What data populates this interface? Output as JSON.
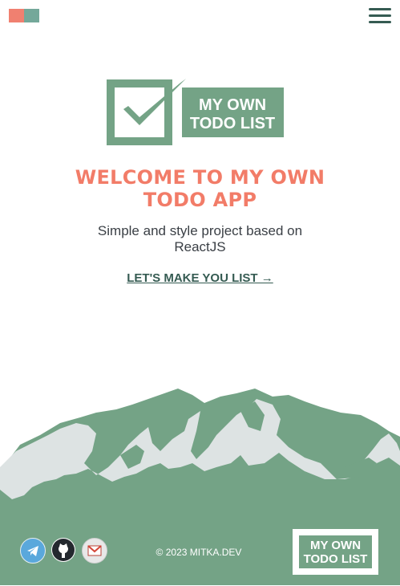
{
  "header": {
    "logo_icon": "brand-squares-icon",
    "menu_icon": "hamburger-menu-icon"
  },
  "hero": {
    "logo_line1": "MY OWN",
    "logo_line2": "TODO LIST",
    "title_line1": "WELCOME TO MY OWN",
    "title_line2": "TODO APP",
    "subtitle": "Simple and style project based on ReactJS",
    "cta_label": "LET'S MAKE YOU LIST →"
  },
  "footer": {
    "social": [
      {
        "name": "telegram-icon"
      },
      {
        "name": "github-icon"
      },
      {
        "name": "gmail-icon"
      }
    ],
    "copyright": "© 2023 MITKA.DEV",
    "logo_line1": "MY OWN",
    "logo_line2": "TODO LIST"
  },
  "colors": {
    "accent": "#f27c68",
    "primary": "#355b52",
    "mountain": "#74a386",
    "snow": "#dde3e3"
  }
}
